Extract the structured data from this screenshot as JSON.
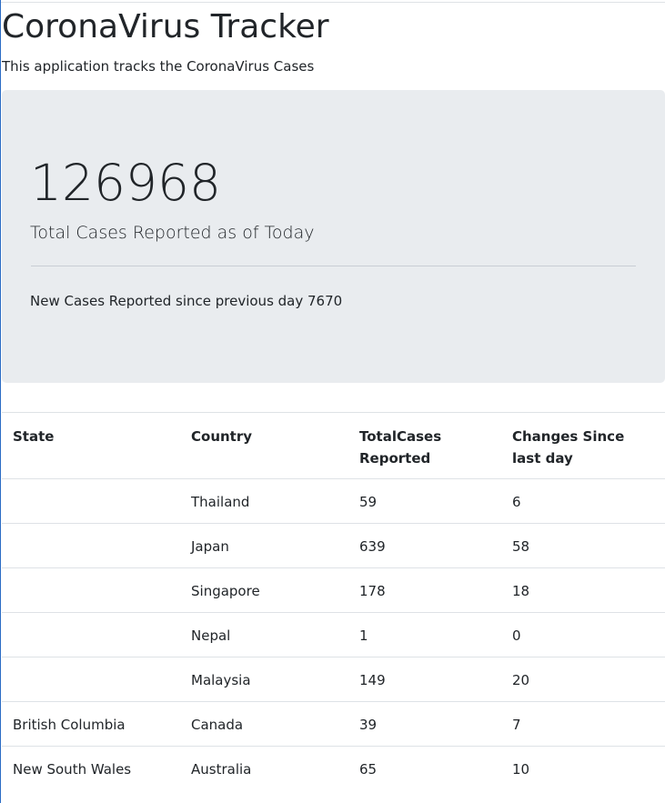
{
  "header": {
    "title": "CoronaVirus Tracker",
    "subtitle": "This application tracks the CoronaVirus Cases"
  },
  "summary": {
    "total_cases": "126968",
    "total_label": "Total Cases Reported as of Today",
    "new_cases_text": "New Cases Reported since previous day 7670"
  },
  "table": {
    "columns": [
      "State",
      "Country",
      "TotalCases Reported",
      "Changes Since last day"
    ],
    "rows": [
      {
        "state": "",
        "country": "Thailand",
        "total": "59",
        "change": "6"
      },
      {
        "state": "",
        "country": "Japan",
        "total": "639",
        "change": "58"
      },
      {
        "state": "",
        "country": "Singapore",
        "total": "178",
        "change": "18"
      },
      {
        "state": "",
        "country": "Nepal",
        "total": "1",
        "change": "0"
      },
      {
        "state": "",
        "country": "Malaysia",
        "total": "149",
        "change": "20"
      },
      {
        "state": "British Columbia",
        "country": "Canada",
        "total": "39",
        "change": "7"
      },
      {
        "state": "New South Wales",
        "country": "Australia",
        "total": "65",
        "change": "10"
      }
    ]
  }
}
